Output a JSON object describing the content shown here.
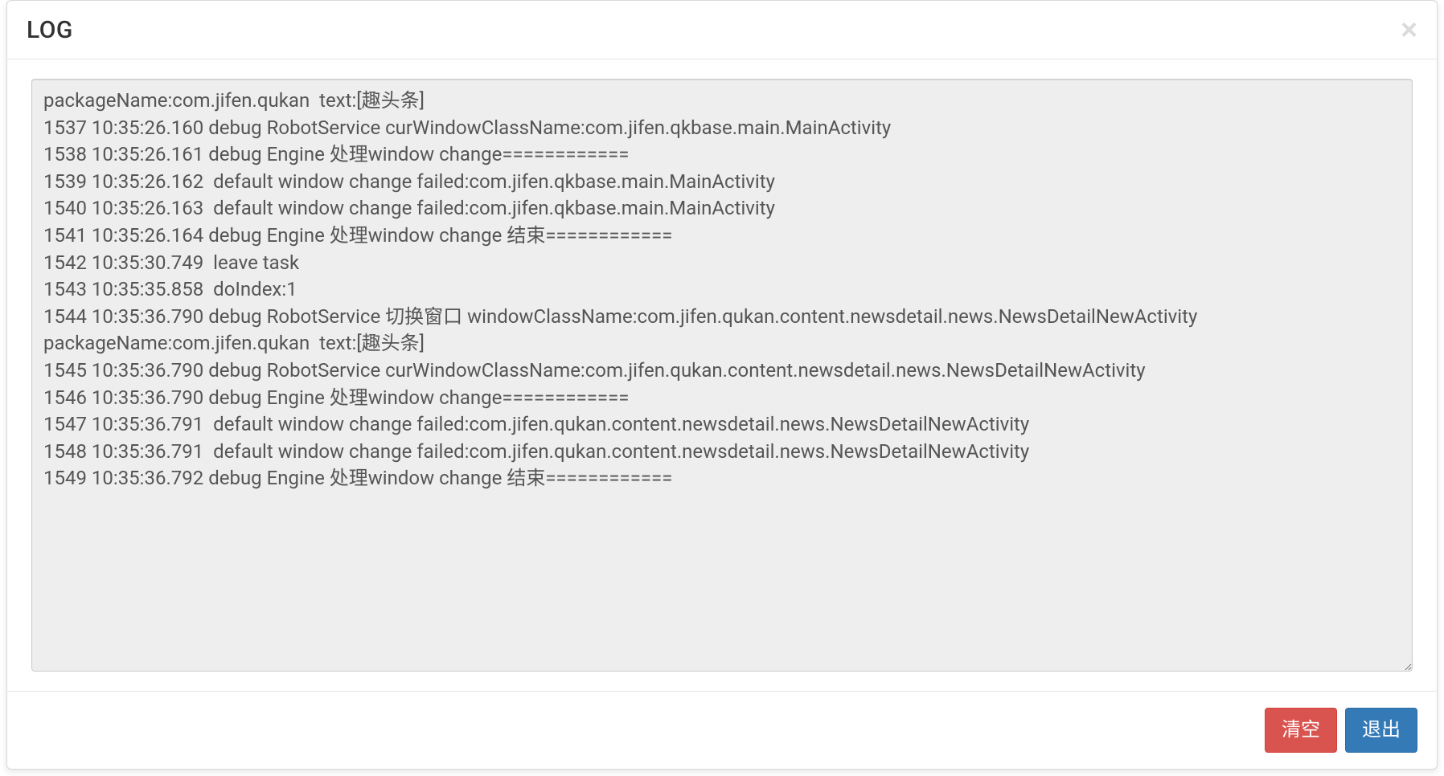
{
  "modal": {
    "title": "LOG",
    "log_content": "packageName:com.jifen.qukan  text:[趣头条]\n1537 10:35:26.160 debug RobotService curWindowClassName:com.jifen.qkbase.main.MainActivity\n1538 10:35:26.161 debug Engine 处理window change============\n1539 10:35:26.162  default window change failed:com.jifen.qkbase.main.MainActivity\n1540 10:35:26.163  default window change failed:com.jifen.qkbase.main.MainActivity\n1541 10:35:26.164 debug Engine 处理window change 结束============\n1542 10:35:30.749  leave task\n1543 10:35:35.858  doIndex:1\n1544 10:35:36.790 debug RobotService 切换窗口 windowClassName:com.jifen.qukan.content.newsdetail.news.NewsDetailNewActivity  packageName:com.jifen.qukan  text:[趣头条]\n1545 10:35:36.790 debug RobotService curWindowClassName:com.jifen.qukan.content.newsdetail.news.NewsDetailNewActivity\n1546 10:35:36.790 debug Engine 处理window change============\n1547 10:35:36.791  default window change failed:com.jifen.qukan.content.newsdetail.news.NewsDetailNewActivity\n1548 10:35:36.791  default window change failed:com.jifen.qukan.content.newsdetail.news.NewsDetailNewActivity\n1549 10:35:36.792 debug Engine 处理window change 结束============",
    "clear_button": "清空",
    "exit_button": "退出"
  }
}
